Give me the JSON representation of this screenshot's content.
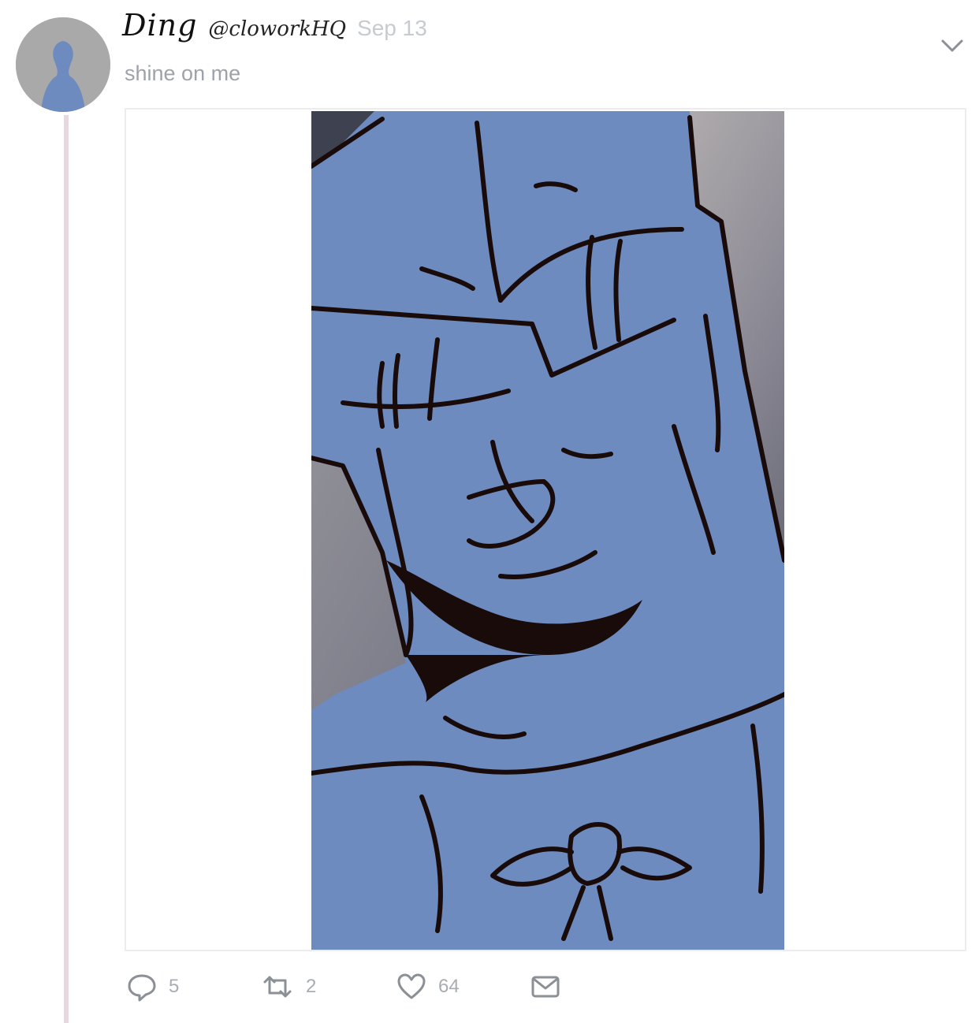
{
  "tweet": {
    "display_name": "Ding",
    "handle": "@cloworkHQ",
    "date": "Sep 13",
    "text": "shine on me"
  },
  "actions": {
    "replies": "5",
    "retweets": "2",
    "likes": "64"
  },
  "icons": {
    "avatar": "default-profile-icon",
    "caret": "chevron-down-icon",
    "reply": "speech-bubble-icon",
    "retweet": "retweet-arrows-icon",
    "like": "heart-icon",
    "dm": "envelope-icon"
  },
  "colors": {
    "art_fill": "#6d8bbf",
    "line": "#1a0b0b",
    "thread_line": "#e8d7df",
    "muted_text": "#9da3a8"
  }
}
